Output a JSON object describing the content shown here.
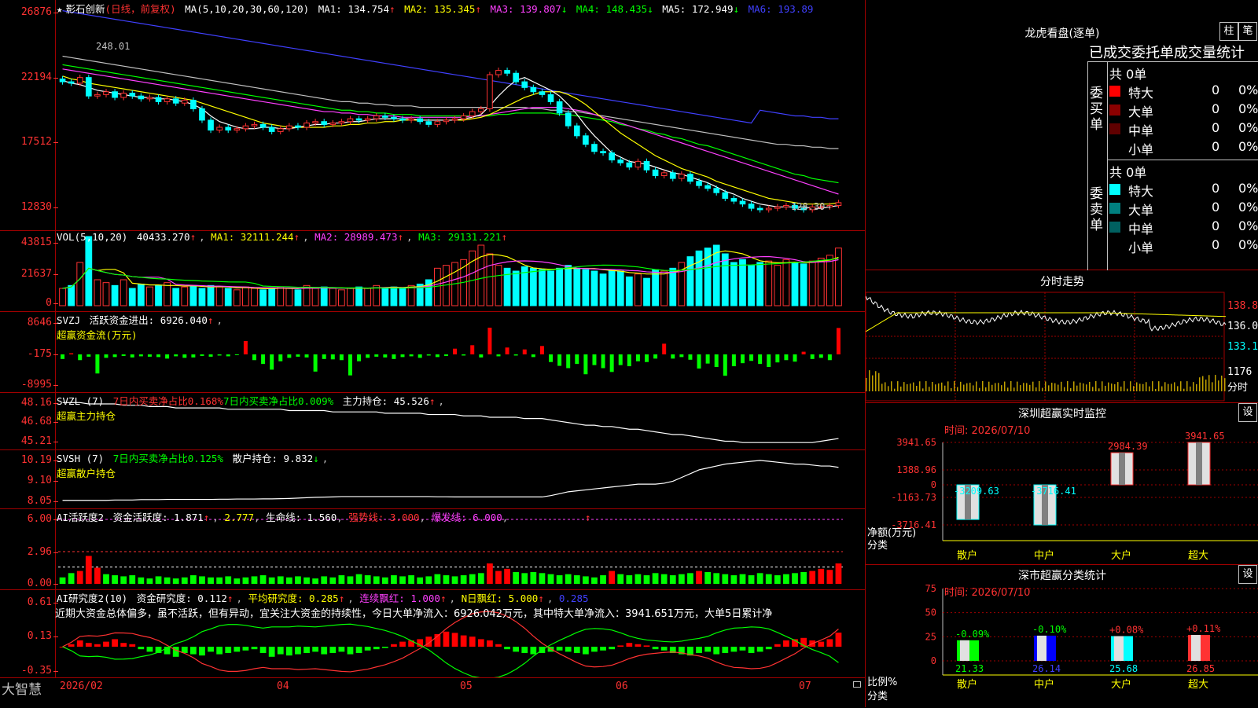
{
  "app": {
    "brand": "大智慧",
    "colors": {
      "up": "#ff3232",
      "down": "#00ffff",
      "ma1": "#ffffff",
      "ma2": "#ffff00",
      "ma3": "#ff40ff",
      "ma4": "#00ff00",
      "ma5": "#c0c0c0",
      "ma6": "#4040ff"
    }
  },
  "kline": {
    "header": {
      "star": "★",
      "name": "影石创新",
      "period": "(日线，前复权)",
      "ma_label": "MA(5,10,20,30,60,120)",
      "ma1": "MA1: 134.754",
      "ma1_arrow": "↑",
      "ma2": "MA2: 135.345",
      "ma2_arrow": "↑",
      "ma3": "MA3: 139.807",
      "ma3_arrow": "↓",
      "ma4": "MA4: 148.435",
      "ma4_arrow": "↓",
      "ma5": "MA5: 172.949",
      "ma5_arrow": "↓",
      "ma6": "MA6: 193.89"
    },
    "yticks": [
      "26876",
      "22194",
      "17512",
      "12830"
    ],
    "high_label": "248.01",
    "low_label": "128.30",
    "low_arrow": "→",
    "closes": [
      220,
      219,
      223,
      210,
      211,
      213,
      209,
      212,
      210,
      208,
      209,
      206,
      208,
      205,
      207,
      201,
      193,
      186,
      188,
      186,
      187,
      189,
      190,
      188,
      185,
      187,
      189,
      188,
      191,
      192,
      190,
      191,
      192,
      194,
      193,
      194,
      196,
      195,
      194,
      193,
      194,
      192,
      190,
      192,
      193,
      194,
      196,
      199,
      201,
      225,
      228,
      226,
      220,
      216,
      213,
      211,
      206,
      198,
      189,
      182,
      176,
      171,
      170,
      165,
      163,
      160,
      164,
      158,
      154,
      156,
      152,
      155,
      150,
      147,
      145,
      142,
      138,
      136,
      134,
      131,
      130,
      131,
      132,
      133,
      131,
      130,
      132,
      132,
      133,
      135
    ],
    "ma1": [
      221,
      219,
      218,
      216,
      214,
      213,
      212,
      211,
      210,
      209,
      209,
      208,
      208,
      207,
      206,
      204,
      201,
      196,
      192,
      190,
      188,
      187,
      187,
      188,
      188,
      187,
      187,
      188,
      189,
      190,
      190,
      191,
      191,
      192,
      192,
      193,
      194,
      194,
      194,
      194,
      194,
      193,
      193,
      193,
      193,
      193,
      194,
      195,
      197,
      203,
      210,
      216,
      221,
      223,
      220,
      217,
      214,
      210,
      204,
      197,
      189,
      182,
      176,
      170,
      167,
      164,
      163,
      162,
      160,
      158,
      156,
      155,
      153,
      151,
      149,
      146,
      143,
      141,
      138,
      136,
      134,
      133,
      132,
      132,
      132,
      132,
      131,
      131,
      132,
      133
    ],
    "ma2": [
      224,
      222,
      221,
      219,
      218,
      217,
      216,
      215,
      214,
      213,
      212,
      211,
      210,
      209,
      208,
      207,
      205,
      203,
      201,
      199,
      197,
      195,
      193,
      191,
      190,
      189,
      188,
      188,
      188,
      188,
      188,
      189,
      189,
      190,
      190,
      191,
      191,
      192,
      192,
      193,
      193,
      193,
      193,
      193,
      193,
      193,
      193,
      194,
      195,
      197,
      200,
      203,
      206,
      209,
      211,
      213,
      213,
      213,
      211,
      208,
      204,
      199,
      194,
      189,
      184,
      180,
      176,
      172,
      168,
      165,
      162,
      159,
      157,
      155,
      153,
      150,
      148,
      146,
      144,
      142,
      140,
      138,
      137,
      136,
      135,
      134,
      134,
      134,
      134,
      135
    ],
    "ma3": [
      229,
      228,
      227,
      226,
      225,
      224,
      223,
      222,
      221,
      220,
      219,
      218,
      217,
      216,
      215,
      214,
      213,
      212,
      211,
      210,
      209,
      208,
      207,
      206,
      205,
      204,
      203,
      202,
      201,
      200,
      199,
      199,
      198,
      198,
      197,
      197,
      196,
      196,
      196,
      195,
      195,
      195,
      195,
      195,
      195,
      195,
      195,
      196,
      196,
      197,
      198,
      199,
      200,
      201,
      202,
      202,
      202,
      202,
      201,
      200,
      199,
      197,
      195,
      193,
      191,
      189,
      187,
      185,
      183,
      181,
      179,
      177,
      175,
      173,
      171,
      169,
      167,
      165,
      163,
      161,
      159,
      157,
      155,
      153,
      151,
      149,
      147,
      145,
      143,
      141
    ],
    "ma4": [
      232,
      231,
      230,
      229,
      228,
      227,
      226,
      225,
      224,
      223,
      222,
      221,
      220,
      219,
      218,
      217,
      216,
      215,
      214,
      213,
      212,
      211,
      210,
      209,
      208,
      207,
      206,
      205,
      204,
      203,
      202,
      201,
      200,
      200,
      199,
      199,
      198,
      198,
      197,
      197,
      197,
      196,
      196,
      196,
      196,
      196,
      196,
      196,
      196,
      196,
      197,
      197,
      198,
      198,
      198,
      198,
      198,
      197,
      197,
      196,
      195,
      194,
      193,
      192,
      190,
      189,
      187,
      186,
      184,
      183,
      181,
      180,
      178,
      176,
      175,
      173,
      171,
      169,
      167,
      165,
      163,
      161,
      159,
      157,
      155,
      154,
      152,
      151,
      150,
      149
    ],
    "ma5": [
      238,
      237,
      236,
      235,
      234,
      233,
      232,
      231,
      230,
      229,
      228,
      227,
      226,
      225,
      224,
      223,
      222,
      221,
      220,
      219,
      218,
      217,
      216,
      215,
      214,
      213,
      212,
      211,
      210,
      209,
      208,
      207,
      206,
      206,
      205,
      205,
      204,
      204,
      203,
      203,
      203,
      202,
      202,
      202,
      202,
      202,
      202,
      202,
      202,
      202,
      202,
      202,
      202,
      202,
      201,
      201,
      200,
      200,
      199,
      199,
      198,
      197,
      196,
      195,
      194,
      193,
      192,
      191,
      190,
      189,
      188,
      187,
      186,
      185,
      184,
      183,
      182,
      181,
      180,
      179,
      178,
      177,
      176,
      176,
      175,
      175,
      174,
      174,
      173,
      173
    ],
    "ma6": [
      270,
      269,
      268,
      267,
      266,
      265,
      264,
      263,
      262,
      261,
      260,
      259,
      258,
      257,
      256,
      255,
      254,
      253,
      252,
      251,
      250,
      249,
      248,
      247,
      246,
      245,
      244,
      243,
      242,
      241,
      240,
      239,
      238,
      237,
      236,
      235,
      234,
      233,
      232,
      231,
      230,
      229,
      228,
      227,
      226,
      225,
      224,
      223,
      222,
      221,
      220,
      219,
      218,
      217,
      216,
      215,
      214,
      213,
      212,
      211,
      210,
      209,
      208,
      207,
      206,
      205,
      204,
      203,
      202,
      201,
      200,
      199,
      198,
      197,
      196,
      195,
      194,
      193,
      192,
      191,
      200,
      199,
      198,
      197,
      196,
      196,
      195,
      195,
      194,
      194
    ]
  },
  "vol": {
    "header": {
      "label": "VOL(5,10,20)",
      "value": "40433.270",
      "value_arrow": "↑",
      "ma1": "MA1: 32111.244",
      "ma1_arrow": "↑",
      "ma2": "MA2: 28989.473",
      "ma2_arrow": "↑",
      "ma3": "MA3: 29131.221",
      "ma3_arrow": "↑"
    },
    "yticks": [
      "43815",
      "21637",
      "0"
    ],
    "bars": [
      12000,
      14000,
      30000,
      48000,
      18000,
      16000,
      14000,
      18000,
      12000,
      15000,
      13000,
      14000,
      16000,
      12000,
      13000,
      14000,
      12000,
      14000,
      13000,
      12000,
      11000,
      13000,
      12000,
      11000,
      12000,
      13000,
      12000,
      11000,
      14000,
      12000,
      13000,
      12000,
      11000,
      12000,
      13000,
      12000,
      14000,
      12000,
      13000,
      12000,
      14000,
      15000,
      18000,
      26000,
      28000,
      30000,
      32000,
      38000,
      42000,
      36000,
      28000,
      26000,
      24000,
      27000,
      26000,
      25000,
      24000,
      26000,
      28000,
      26000,
      25000,
      24000,
      22000,
      25000,
      24000,
      20000,
      22000,
      19000,
      25000,
      24000,
      26000,
      30000,
      34000,
      38000,
      40000,
      42000,
      36000,
      30000,
      32000,
      28000,
      30000,
      31000,
      28000,
      32000,
      30000,
      29000,
      31000,
      33000,
      35000,
      40000
    ]
  },
  "svzj": {
    "header": {
      "label": "SVZJ",
      "text": "活跃资金进出: 6926.040",
      "arrow": "↑",
      "sub": "超赢资金流(万元)"
    },
    "yticks": [
      "8646",
      "-175",
      "-8995"
    ],
    "values": [
      -1200,
      300,
      -1500,
      -600,
      -5000,
      -900,
      -700,
      -400,
      -800,
      -500,
      -600,
      -700,
      -1100,
      -500,
      -900,
      -800,
      -400,
      -600,
      -300,
      -500,
      -200,
      3500,
      -1500,
      -2500,
      -4000,
      -1800,
      -900,
      -600,
      -800,
      -4500,
      -1200,
      -1300,
      -1500,
      -5500,
      -1800,
      -900,
      -600,
      -800,
      -1200,
      -700,
      -500,
      -900,
      -300,
      -700,
      -400,
      1500,
      -300,
      2400,
      -800,
      7000,
      -500,
      1800,
      -300,
      1300,
      -700,
      2200,
      -2000,
      -3000,
      -3600,
      -2500,
      -5200,
      -2800,
      -3600,
      -4600,
      -2800,
      -3100,
      -1800,
      -2000,
      -1100,
      2800,
      -1100,
      -700,
      -1400,
      -3700,
      -2400,
      -3300,
      -5600,
      -3100,
      -2300,
      -1700,
      -2500,
      -3300,
      -2100,
      -1500,
      -1900,
      700,
      -1200,
      -900,
      -1500,
      6926
    ]
  },
  "svzl": {
    "header": {
      "label": "SVZL (7)",
      "text1": "7日内买卖净占比0.168%",
      "text2": "7日内买卖净占比0.009%",
      "text3": "主力持仓: 45.526",
      "arrow": "↑",
      "sub": "超赢主力持仓"
    },
    "yticks": [
      "48.16",
      "46.68",
      "45.21"
    ],
    "values": [
      48.2,
      48.2,
      48.2,
      48.1,
      48.1,
      48.1,
      48.1,
      48.0,
      48.0,
      48.0,
      47.9,
      47.9,
      47.9,
      47.8,
      47.8,
      47.8,
      47.8,
      47.8,
      47.8,
      47.7,
      47.7,
      47.7,
      47.7,
      47.7,
      47.7,
      47.7,
      47.6,
      47.6,
      47.6,
      47.6,
      47.6,
      47.5,
      47.5,
      47.5,
      47.5,
      47.5,
      47.5,
      47.4,
      47.4,
      47.4,
      47.4,
      47.4,
      47.3,
      47.3,
      47.3,
      47.3,
      47.2,
      47.2,
      47.2,
      47.1,
      47.1,
      47.1,
      47.1,
      47.0,
      47.0,
      47.0,
      46.9,
      46.8,
      46.7,
      46.6,
      46.5,
      46.5,
      46.4,
      46.4,
      46.3,
      46.2,
      46.2,
      46.1,
      46.0,
      45.9,
      45.8,
      45.8,
      45.7,
      45.6,
      45.5,
      45.4,
      45.3,
      45.3,
      45.2,
      45.2,
      45.2,
      45.2,
      45.2,
      45.2,
      45.2,
      45.2,
      45.2,
      45.3,
      45.4,
      45.5
    ]
  },
  "svsh": {
    "header": {
      "label": "SVSH (7)",
      "text1": "7日内买卖净占比0.125%",
      "text2": "散户持仓: 9.832",
      "arrow": "↓",
      "sub": "超赢散户持仓"
    },
    "yticks": [
      "10.19",
      "9.10",
      "8.05"
    ],
    "values": [
      8.1,
      8.1,
      8.1,
      8.1,
      8.1,
      8.1,
      8.12,
      8.12,
      8.12,
      8.14,
      8.14,
      8.14,
      8.15,
      8.15,
      8.15,
      8.15,
      8.15,
      8.15,
      8.16,
      8.16,
      8.17,
      8.17,
      8.17,
      8.18,
      8.18,
      8.19,
      8.2,
      8.22,
      8.24,
      8.26,
      8.27,
      8.28,
      8.3,
      8.3,
      8.3,
      8.3,
      8.3,
      8.3,
      8.3,
      8.3,
      8.3,
      8.3,
      8.3,
      8.29,
      8.29,
      8.28,
      8.28,
      8.28,
      8.28,
      8.28,
      8.28,
      8.28,
      8.28,
      8.28,
      8.28,
      8.28,
      8.35,
      8.45,
      8.55,
      8.6,
      8.65,
      8.7,
      8.75,
      8.8,
      8.85,
      8.9,
      8.95,
      8.95,
      8.95,
      9.0,
      9.1,
      9.3,
      9.5,
      9.7,
      9.8,
      9.9,
      10.0,
      10.05,
      10.1,
      10.15,
      10.19,
      10.15,
      10.1,
      10.05,
      10.0,
      10.0,
      9.95,
      9.9,
      9.9,
      9.83
    ]
  },
  "ai_active": {
    "header": {
      "label": "AI活跃度2",
      "text1": "资金活跃度: 1.871",
      "arrow1": "↑",
      "text2": "2.777",
      "text3": "生命线: 1.560",
      "text4": "强势线: 3.000",
      "text5": "爆发线: 6.000",
      "arrow2": "↑"
    },
    "yticks": [
      "6.00",
      "2.96",
      "0.00"
    ],
    "values": [
      0.6,
      1.0,
      1.2,
      2.6,
      1.5,
      0.9,
      0.8,
      0.7,
      0.8,
      0.6,
      0.5,
      0.7,
      0.6,
      0.5,
      0.6,
      0.8,
      0.7,
      0.6,
      0.6,
      0.7,
      0.5,
      0.6,
      0.7,
      0.8,
      0.6,
      0.7,
      0.6,
      0.7,
      0.6,
      0.5,
      0.7,
      0.6,
      0.8,
      0.7,
      0.9,
      0.8,
      0.7,
      0.6,
      0.8,
      0.7,
      0.8,
      0.6,
      0.7,
      0.9,
      0.8,
      0.7,
      0.8,
      0.9,
      1.0,
      1.9,
      1.2,
      1.4,
      1.1,
      1.0,
      1.1,
      1.0,
      0.9,
      0.8,
      0.9,
      0.8,
      0.7,
      0.6,
      0.8,
      1.2,
      0.9,
      0.8,
      0.9,
      0.8,
      1.0,
      0.9,
      0.8,
      0.9,
      1.0,
      1.2,
      1.1,
      1.0,
      0.9,
      0.8,
      0.9,
      0.8,
      1.0,
      0.9,
      0.8,
      0.9,
      1.0,
      1.1,
      1.2,
      1.4,
      1.3,
      1.9
    ]
  },
  "ai_research": {
    "header": {
      "label": "AI研究度2(10)",
      "text1": "资金研究度: 0.112",
      "arrow1": "↑",
      "text2": "平均研究度: 0.285",
      "arrow2": "↑",
      "text3": "连续飘红: 1.000",
      "arrow3": "↑",
      "text4": "N日飘红: 5.000",
      "arrow4": "↑",
      "text5": "0.285"
    },
    "commentary": "近期大资金总体偏多，虽不活跃，但有异动，宜关注大资金的持续性，今日大单净流入：6926.042万元，其中特大单净流入：3941.651万元，大单5日累计净",
    "yticks": [
      "0.61",
      "0.13",
      "-0.35"
    ],
    "values": [
      0.0,
      0.02,
      0.05,
      0.03,
      0.02,
      0.04,
      0.06,
      0.03,
      0.02,
      -0.02,
      -0.04,
      -0.05,
      -0.06,
      -0.08,
      -0.05,
      -0.06,
      -0.07,
      -0.04,
      -0.06,
      -0.05,
      -0.04,
      -0.03,
      -0.02,
      -0.05,
      -0.08,
      -0.06,
      -0.07,
      -0.06,
      -0.05,
      -0.04,
      -0.06,
      -0.05,
      -0.04,
      -0.06,
      -0.05,
      -0.03,
      -0.02,
      -0.01,
      0.02,
      0.04,
      0.05,
      0.06,
      0.08,
      0.1,
      0.12,
      0.11,
      0.09,
      0.08,
      0.06,
      0.05,
      0.02,
      -0.02,
      -0.04,
      -0.05,
      -0.06,
      -0.05,
      -0.04,
      -0.03,
      -0.04,
      -0.05,
      -0.06,
      -0.04,
      -0.03,
      -0.02,
      0.01,
      0.03,
      0.02,
      0.01,
      -0.02,
      -0.03,
      -0.05,
      -0.06,
      -0.07,
      -0.05,
      -0.04,
      -0.06,
      -0.05,
      -0.04,
      -0.03,
      -0.05,
      -0.04,
      -0.02,
      0.02,
      0.05,
      0.06,
      0.07,
      0.05,
      0.04,
      0.06,
      0.112
    ]
  },
  "x_axis": {
    "labels": [
      "2026/02",
      "04",
      "05",
      "06",
      "07"
    ]
  },
  "right": {
    "dragon": {
      "title": "龙虎看盘(逐单)",
      "btn1": "柱",
      "btn2": "笔",
      "subtitle": "已成交委托单成交量统计",
      "buy_label": "委买单",
      "sell_label": "委卖单",
      "buy_total": "共 0单",
      "sell_total": "共 0单",
      "buy_rows": [
        {
          "name": "特大",
          "val": "0",
          "pct": "0%",
          "color": "#ff0000"
        },
        {
          "name": "大单",
          "val": "0",
          "pct": "0%",
          "color": "#8b0000"
        },
        {
          "name": "中单",
          "val": "0",
          "pct": "0%",
          "color": "#600000"
        },
        {
          "name": "小单",
          "val": "0",
          "pct": "0%",
          "color": ""
        }
      ],
      "sell_rows": [
        {
          "name": "特大",
          "val": "0",
          "pct": "0%",
          "color": "#00ffff"
        },
        {
          "name": "大单",
          "val": "0",
          "pct": "0%",
          "color": "#008080"
        },
        {
          "name": "中单",
          "val": "0",
          "pct": "0%",
          "color": "#006060"
        },
        {
          "name": "小单",
          "val": "0",
          "pct": "0%",
          "color": ""
        }
      ]
    },
    "intraday": {
      "title": "分时走势",
      "y1": "138.8",
      "y2": "136.0",
      "y3": "133.1",
      "vol_label": "1176",
      "unit": "分时"
    },
    "monitor": {
      "title": "深圳超赢实时监控",
      "btn": "设",
      "time": "时间: 2026/07/10",
      "yticks": [
        "3941.65",
        "1388.96",
        "0",
        "-1163.73",
        "-3716.41"
      ],
      "ylabel1": "净额(万元)",
      "ylabel2": "分类",
      "cats": [
        "散户",
        "中户",
        "大户",
        "超大"
      ],
      "values": [
        -3209.63,
        -3716.41,
        2984.39,
        3941.65
      ],
      "labels": [
        "-3209.63",
        "-3716.41",
        "2984.39",
        "3941.65"
      ]
    },
    "classify": {
      "title": "深市超赢分类统计",
      "btn": "设",
      "time": "时间: 2026/07/10",
      "yticks": [
        "75",
        "50",
        "25",
        "0"
      ],
      "ylabel1": "比例%",
      "ylabel2": "分类",
      "cats": [
        "散户",
        "中户",
        "大户",
        "超大"
      ],
      "values": [
        21.33,
        26.14,
        25.68,
        26.85
      ],
      "labels": [
        "21.33",
        "26.14",
        "25.68",
        "26.85"
      ],
      "changes": [
        "-0.09%",
        "-0.10%",
        "+0.08%",
        "+0.11%"
      ],
      "colors": [
        "#00ff00",
        "#0000ff",
        "#00ffff",
        "#ff3232"
      ]
    }
  }
}
